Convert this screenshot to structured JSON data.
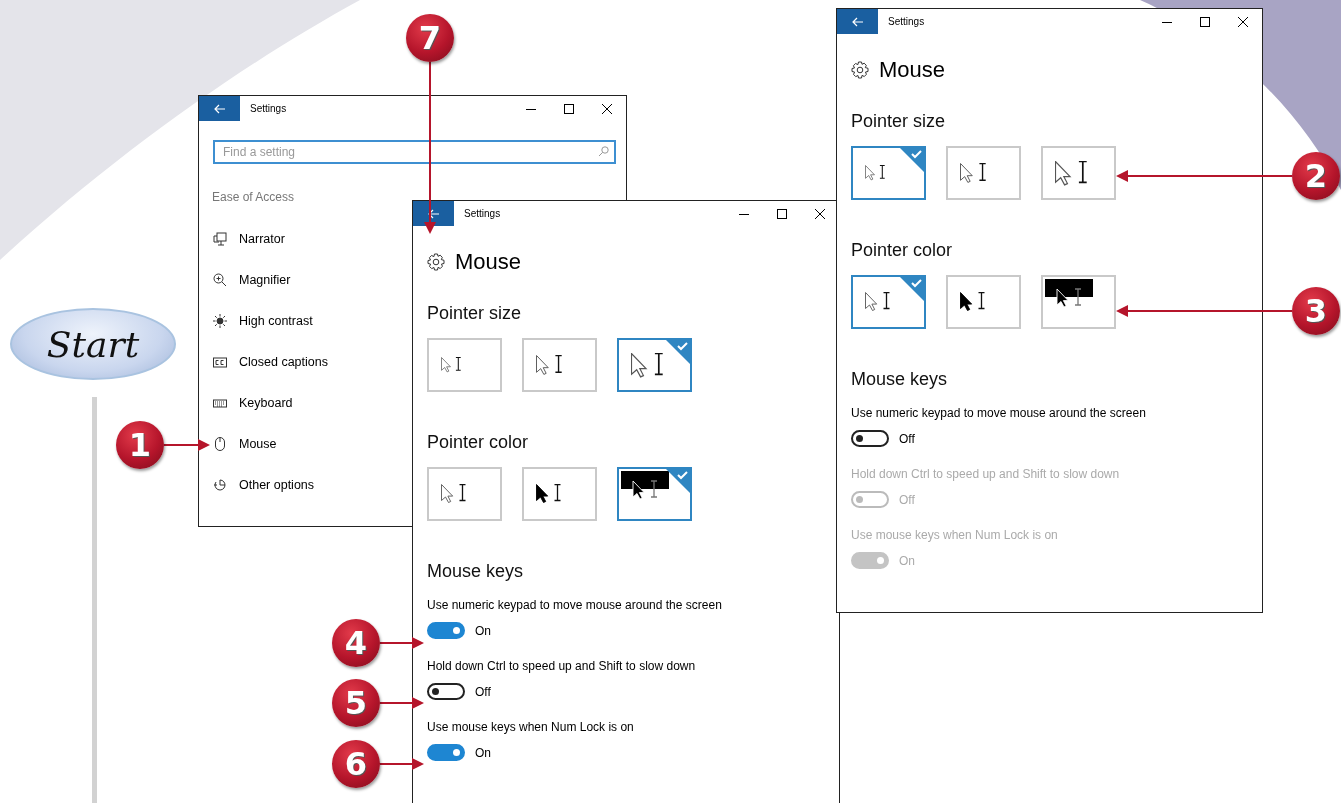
{
  "start_badge": {
    "label": "Start"
  },
  "windows": [
    {
      "kind": "menu",
      "title": "Settings",
      "search": {
        "placeholder": "Find a setting"
      },
      "section": "Ease of Access",
      "items": [
        {
          "label": "Narrator",
          "kind": "narrator"
        },
        {
          "label": "Magnifier",
          "kind": "magnifier"
        },
        {
          "label": "High contrast",
          "kind": "contrast"
        },
        {
          "label": "Closed captions",
          "kind": "captions"
        },
        {
          "label": "Keyboard",
          "kind": "keyboard"
        },
        {
          "label": "Mouse",
          "kind": "mouse"
        },
        {
          "label": "Other options",
          "kind": "other"
        }
      ]
    },
    {
      "kind": "mouse",
      "title": "Settings",
      "heading": "Mouse",
      "pointer_size": {
        "label": "Pointer size",
        "options": [
          {
            "kind": "small",
            "selected": false
          },
          {
            "kind": "medium",
            "selected": false
          },
          {
            "kind": "large",
            "selected": true
          }
        ]
      },
      "pointer_color": {
        "label": "Pointer color",
        "options": [
          {
            "kind": "white",
            "selected": false
          },
          {
            "kind": "black",
            "selected": false
          },
          {
            "kind": "inverted",
            "selected": true
          }
        ]
      },
      "mouse_keys": {
        "label": "Mouse keys",
        "toggles": [
          {
            "label": "Use numeric keypad to move mouse around the screen",
            "on": true,
            "disabled": false,
            "status": "On"
          },
          {
            "label": "Hold down Ctrl to speed up and Shift to slow down",
            "on": false,
            "disabled": false,
            "status": "Off"
          },
          {
            "label": "Use mouse keys when Num Lock is on",
            "on": true,
            "disabled": false,
            "status": "On"
          }
        ]
      }
    },
    {
      "kind": "mouse",
      "title": "Settings",
      "heading": "Mouse",
      "pointer_size": {
        "label": "Pointer size",
        "options": [
          {
            "kind": "small",
            "selected": true
          },
          {
            "kind": "medium",
            "selected": false
          },
          {
            "kind": "large",
            "selected": false
          }
        ]
      },
      "pointer_color": {
        "label": "Pointer color",
        "options": [
          {
            "kind": "white",
            "selected": true
          },
          {
            "kind": "black",
            "selected": false
          },
          {
            "kind": "inverted",
            "selected": false
          }
        ]
      },
      "mouse_keys": {
        "label": "Mouse keys",
        "toggles": [
          {
            "label": "Use numeric keypad to move mouse around the screen",
            "on": false,
            "disabled": false,
            "status": "Off"
          },
          {
            "label": "Hold down Ctrl to speed up and Shift to slow down",
            "on": false,
            "disabled": true,
            "status": "Off"
          },
          {
            "label": "Use mouse keys when Num Lock is on",
            "on": true,
            "disabled": true,
            "status": "On"
          }
        ]
      }
    }
  ],
  "callouts": [
    {
      "number": "1"
    },
    {
      "number": "2"
    },
    {
      "number": "3"
    },
    {
      "number": "4"
    },
    {
      "number": "5"
    },
    {
      "number": "6"
    },
    {
      "number": "7"
    }
  ]
}
